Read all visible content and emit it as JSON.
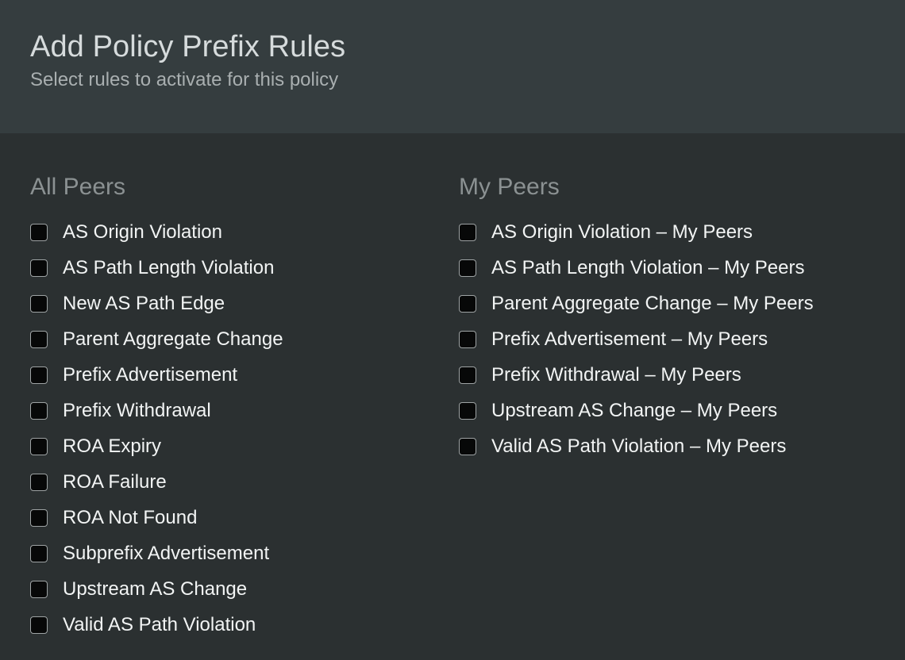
{
  "header": {
    "title": "Add Policy Prefix Rules",
    "subtitle": "Select rules to activate for this policy"
  },
  "colors": {
    "header_background": "#353d3f",
    "body_background": "#2b3031",
    "title_text": "#d6dbdc",
    "subtitle_text": "#a9afb0",
    "column_heading_text": "#8b9192",
    "item_text": "#f2f4f4",
    "checkbox_fill": "#070808",
    "checkbox_border": "#9ea3a4"
  },
  "columns": [
    {
      "heading": "All Peers",
      "items": [
        {
          "label": "AS Origin Violation",
          "checked": false
        },
        {
          "label": "AS Path Length Violation",
          "checked": false
        },
        {
          "label": "New AS Path Edge",
          "checked": false
        },
        {
          "label": "Parent Aggregate Change",
          "checked": false
        },
        {
          "label": "Prefix Advertisement",
          "checked": false
        },
        {
          "label": "Prefix Withdrawal",
          "checked": false
        },
        {
          "label": "ROA Expiry",
          "checked": false
        },
        {
          "label": "ROA Failure",
          "checked": false
        },
        {
          "label": "ROA Not Found",
          "checked": false
        },
        {
          "label": "Subprefix Advertisement",
          "checked": false
        },
        {
          "label": "Upstream AS Change",
          "checked": false
        },
        {
          "label": "Valid AS Path Violation",
          "checked": false
        }
      ]
    },
    {
      "heading": "My Peers",
      "items": [
        {
          "label": "AS Origin Violation – My Peers",
          "checked": false
        },
        {
          "label": "AS Path Length Violation – My Peers",
          "checked": false
        },
        {
          "label": "Parent Aggregate Change – My Peers",
          "checked": false
        },
        {
          "label": "Prefix Advertisement – My Peers",
          "checked": false
        },
        {
          "label": "Prefix Withdrawal – My Peers",
          "checked": false
        },
        {
          "label": "Upstream AS Change – My Peers",
          "checked": false
        },
        {
          "label": "Valid AS Path Violation – My Peers",
          "checked": false
        }
      ]
    }
  ]
}
